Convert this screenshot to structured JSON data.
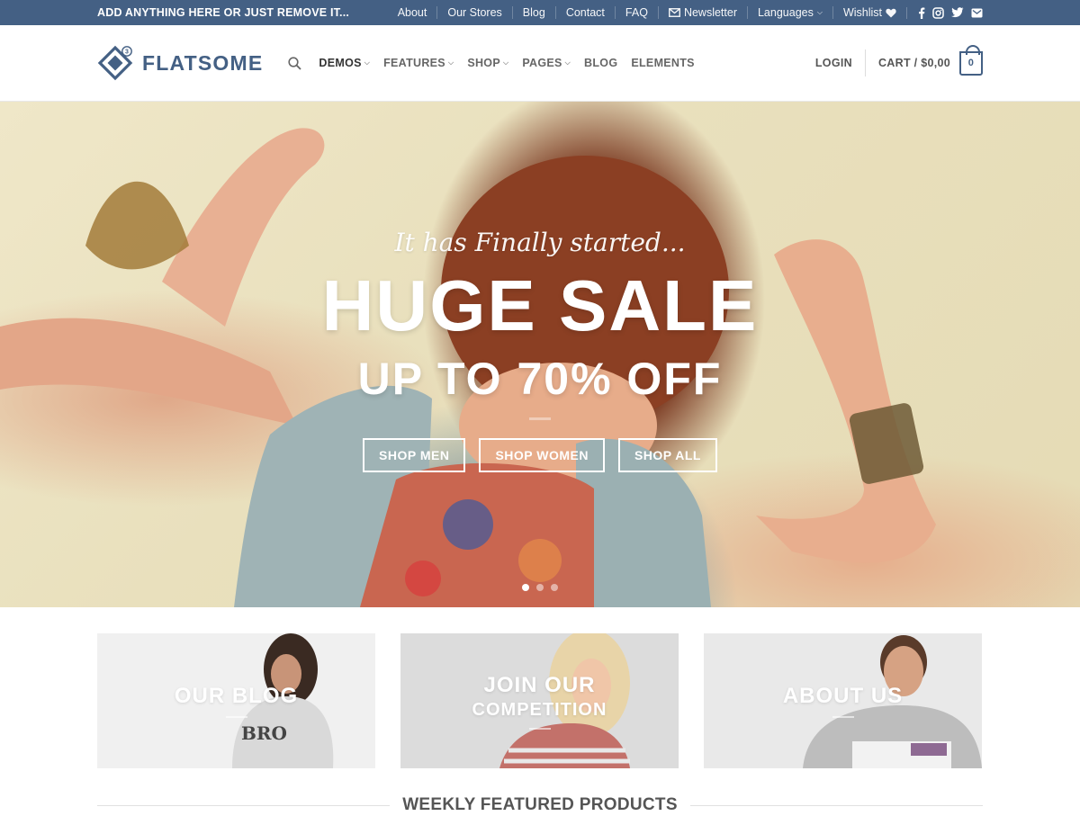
{
  "topbar": {
    "promo": "ADD ANYTHING HERE OR JUST REMOVE IT...",
    "links": [
      "About",
      "Our Stores",
      "Blog",
      "Contact",
      "FAQ"
    ],
    "newsletter": "Newsletter",
    "languages": "Languages",
    "wishlist": "Wishlist",
    "social_icons": [
      "facebook-icon",
      "instagram-icon",
      "twitter-icon",
      "email-icon"
    ]
  },
  "header": {
    "logo_text": "FLATSOME",
    "logo_badge": "3",
    "nav": [
      {
        "label": "DEMOS",
        "dropdown": true,
        "active": true
      },
      {
        "label": "FEATURES",
        "dropdown": true
      },
      {
        "label": "SHOP",
        "dropdown": true
      },
      {
        "label": "PAGES",
        "dropdown": true
      },
      {
        "label": "BLOG",
        "dropdown": false
      },
      {
        "label": "ELEMENTS",
        "dropdown": false
      }
    ],
    "login": "LOGIN",
    "cart_label": "CART / $0,00",
    "cart_count": "0"
  },
  "hero": {
    "script": "It has Finally started...",
    "title": "HUGE SALE",
    "subtitle": "UP TO 70% OFF",
    "buttons": [
      "SHOP MEN",
      "SHOP WOMEN",
      "SHOP ALL"
    ],
    "slides": 3,
    "active_slide": 1
  },
  "banners": [
    {
      "line1": "OUR BLOG",
      "line2": ""
    },
    {
      "line1": "JOIN OUR",
      "line2": "COMPETITION"
    },
    {
      "line1": "ABOUT US",
      "line2": ""
    }
  ],
  "section": {
    "title": "WEEKLY FEATURED PRODUCTS"
  },
  "colors": {
    "primary": "#446084",
    "topbar_text": "#ffffff",
    "hero_bg": "#ebe2c0"
  }
}
